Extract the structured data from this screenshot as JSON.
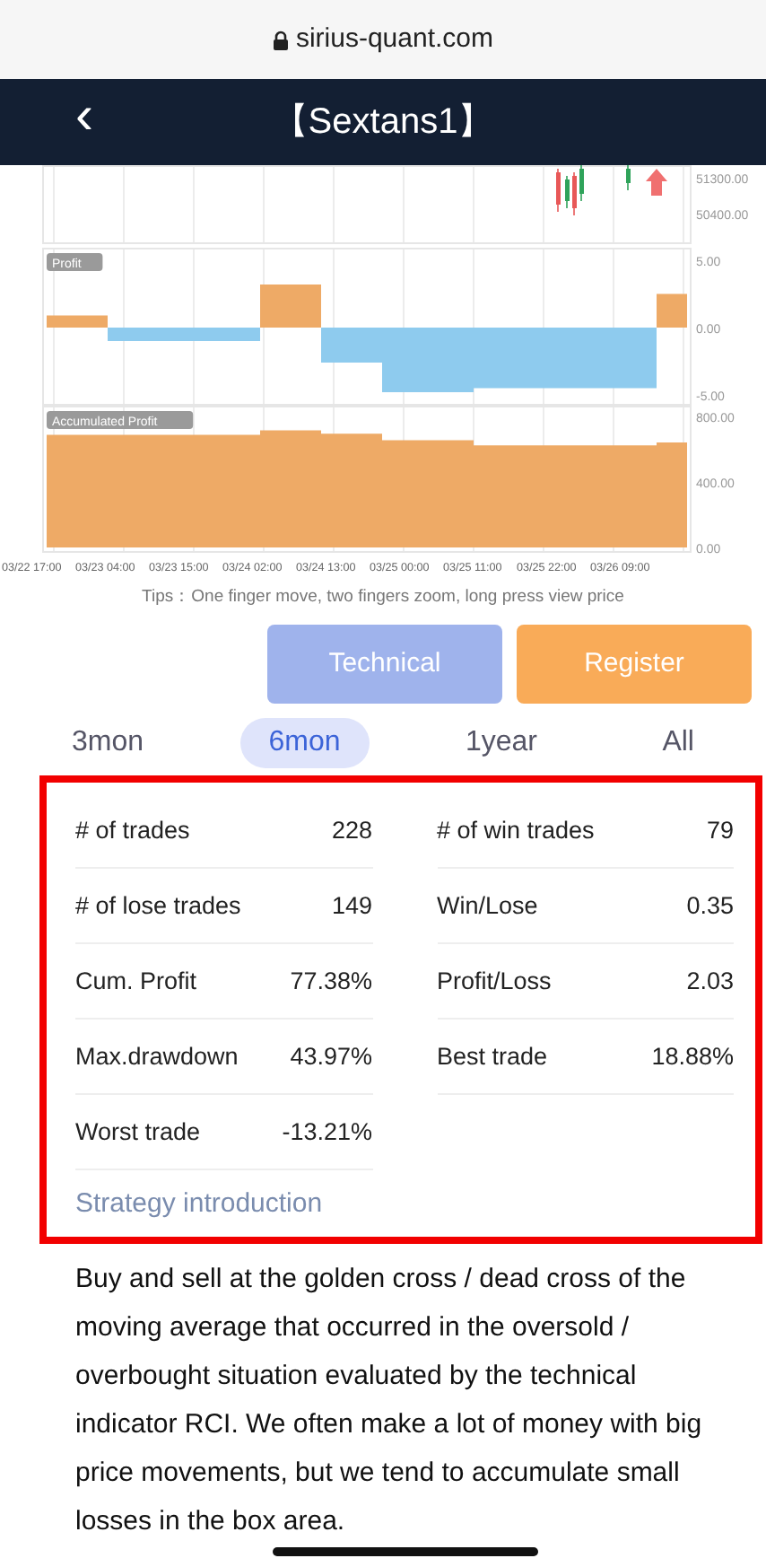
{
  "browser_bar": {
    "url": "sirius-quant.com"
  },
  "header": {
    "back": "‹",
    "title": "【Sextans1】"
  },
  "price_chart": {
    "axis_labels": [
      "51300.00",
      "50400.00"
    ]
  },
  "profit_chart": {
    "label": "Profit",
    "axis_labels": [
      "5.00",
      "0.00",
      "-5.00"
    ]
  },
  "accumulated_chart": {
    "label": "Accumulated Profit",
    "axis_labels": [
      "800.00",
      "400.00",
      "0.00"
    ],
    "time_labels": [
      "03/22 17:00",
      "03/23 04:00",
      "03/23 15:00",
      "03/24 02:00",
      "03/24 13:00",
      "03/25 00:00",
      "03/25 11:00",
      "03/25 22:00",
      "03/26 09:00"
    ]
  },
  "tips": "Tips：One finger move, two fingers zoom, long press view price",
  "buttons": [
    {
      "label": "Technical",
      "kind": "secondary"
    },
    {
      "label": "Register",
      "kind": "primary"
    }
  ],
  "periods": [
    {
      "label": "3mon",
      "selected": false
    },
    {
      "label": "6mon",
      "selected": true
    },
    {
      "label": "1year",
      "selected": false
    },
    {
      "label": "All",
      "selected": false
    }
  ],
  "stats": {
    "highlighted": true,
    "items": [
      {
        "label": "# of trades",
        "value": "228"
      },
      {
        "label": "# of win trades",
        "value": "79"
      },
      {
        "label": "# of lose trades",
        "value": "149"
      },
      {
        "label": "Win/Lose",
        "value": "0.35"
      },
      {
        "label": "Cum. Profit",
        "value": "77.38%"
      },
      {
        "label": "Profit/Loss",
        "value": "2.03"
      },
      {
        "label": "Max.drawdown",
        "value": "43.97%"
      },
      {
        "label": "Best trade",
        "value": "18.88%"
      },
      {
        "label": "Worst trade",
        "value": "-13.21%"
      }
    ],
    "section_title": "Strategy introduction"
  },
  "description": "Buy and sell at the golden cross / dead cross of the moving average that occurred in the oversold / overbought situation evaluated by the technical indicator RCI. We often make a lot of money with big price movements, but we tend to accumulate small losses in the box area."
}
